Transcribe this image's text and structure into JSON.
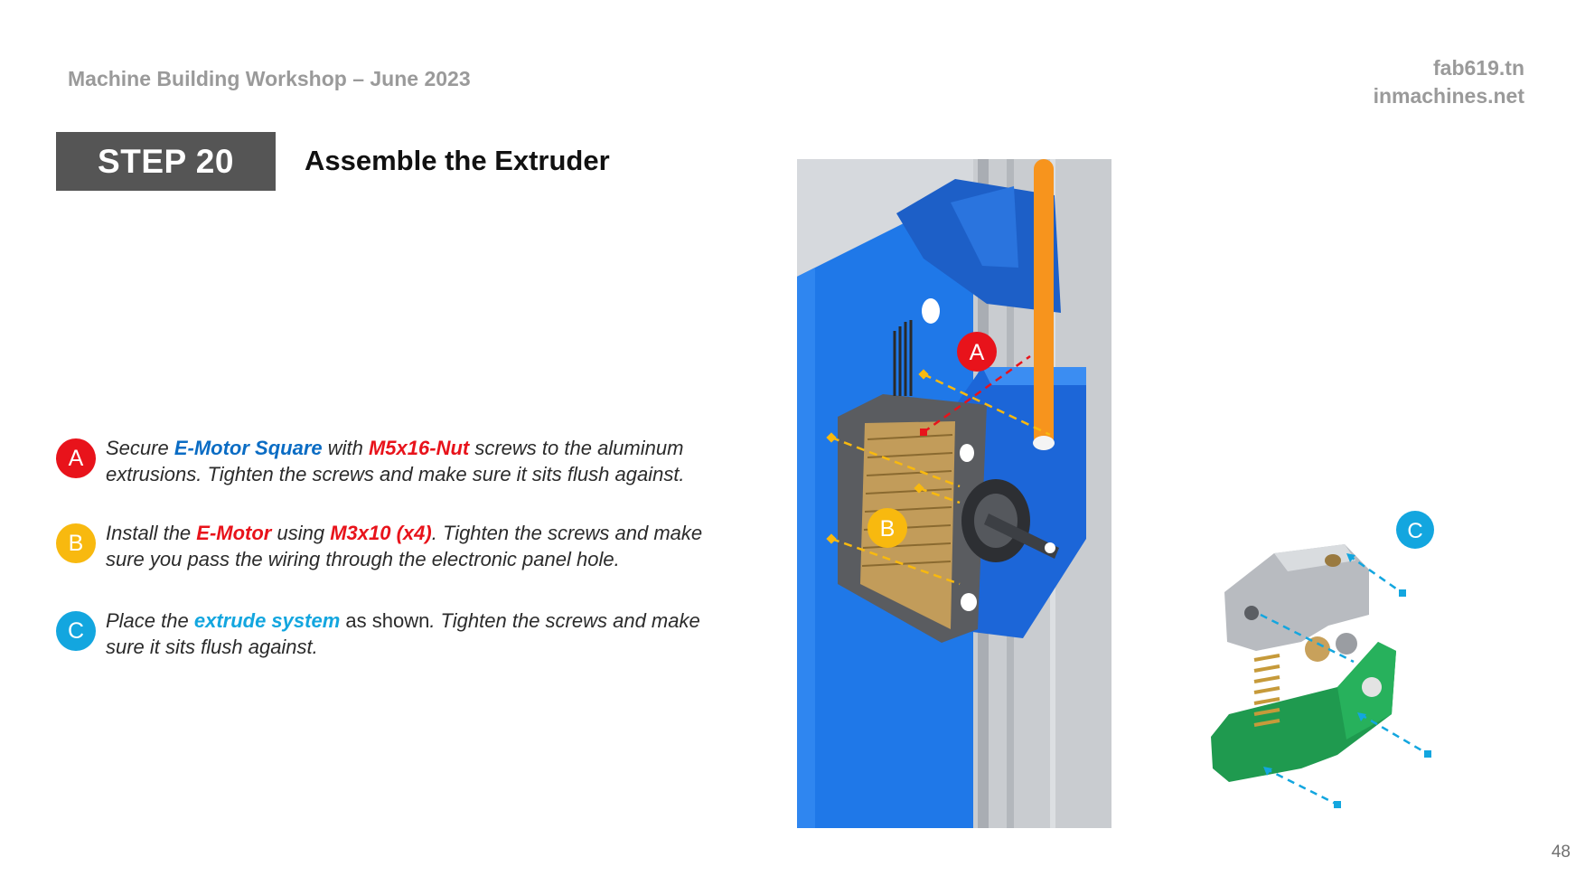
{
  "header": {
    "title": "Machine Building Workshop – June 2023",
    "site1": "fab619.tn",
    "site2": "inmachines.net"
  },
  "step": {
    "label": "STEP 20",
    "title": "Assemble the Extruder"
  },
  "instructions": [
    {
      "badge": "A",
      "color": "#e8131b",
      "p1": "Secure ",
      "k1": "E-Motor Square",
      "p2": " with  ",
      "k2": "M5x16-Nut",
      "p3": " screws to the aluminum extrusions. Tighten the screws and make sure it sits flush against."
    },
    {
      "badge": "B",
      "color": "#f8b90f",
      "p1": "Install the ",
      "k1": "E-Motor",
      "p2": " using ",
      "k2": "M3x10 (x4)",
      "p3": ". Tighten the screws and make sure you pass the wiring through the electronic panel hole."
    },
    {
      "badge": "C",
      "color": "#13a6df",
      "p1": "Place the ",
      "k1": "extrude system",
      "p2": " as shown",
      "p3": ". Tighten the screws and make sure it sits flush against."
    }
  ],
  "figure_labels": {
    "a": "A",
    "b": "B",
    "c": "C"
  },
  "colors": {
    "red": "#e8131b",
    "yellow": "#f8b90f",
    "cyan": "#13a6df",
    "blue_panel": "#1f78e8",
    "filament": "#f7941d",
    "step_box": "#555555"
  },
  "page_number": "48"
}
